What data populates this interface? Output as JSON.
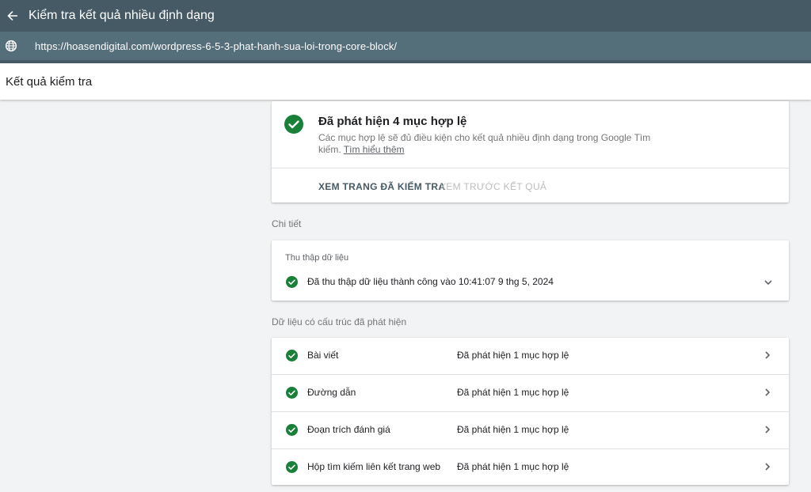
{
  "header": {
    "title": "Kiểm tra kết quả nhiều định dạng"
  },
  "url_bar": {
    "url": "https://hoasendigital.com/wordpress-6-5-3-phat-hanh-sua-loi-trong-core-block/"
  },
  "results": {
    "title": "Kết quả kiểm tra"
  },
  "summary": {
    "title": "Đã phát hiện 4 mục hợp lệ",
    "description": "Các mục hợp lệ sẽ đủ điều kiện cho kết quả nhiều định dạng trong Google Tìm kiếm. ",
    "learn_more": "Tìm hiểu thêm",
    "view_tested_page": "XEM TRANG ĐÃ KIỂM TRA",
    "preview_results": "XEM TRƯỚC KẾT QUẢ"
  },
  "details": {
    "label": "Chi tiết",
    "crawl": {
      "label": "Thu thập dữ liệu",
      "status": "Đã thu thập dữ liệu thành công vào 10:41:07 9 thg 5, 2024"
    }
  },
  "structured_data": {
    "label": "Dữ liệu có cấu trúc đã phát hiện",
    "items": [
      {
        "name": "Bài viết",
        "status": "Đã phát hiện 1 mục hợp lệ"
      },
      {
        "name": "Đường dẫn",
        "status": "Đã phát hiện 1 mục hợp lệ"
      },
      {
        "name": "Đoạn trích đánh giá",
        "status": "Đã phát hiện 1 mục hợp lệ"
      },
      {
        "name": "Hộp tìm kiếm liên kết trang web",
        "status": "Đã phát hiện 1 mục hợp lệ"
      }
    ]
  },
  "colors": {
    "header_bg": "#455a64",
    "urlbar_bg": "#546e7a",
    "success_green": "#188038",
    "page_bg": "#f1f3f4"
  },
  "icons": {
    "back": "arrow-left-icon",
    "globe": "globe-icon",
    "check": "check-circle-icon",
    "expand": "chevron-down-icon",
    "open": "chevron-right-icon"
  }
}
